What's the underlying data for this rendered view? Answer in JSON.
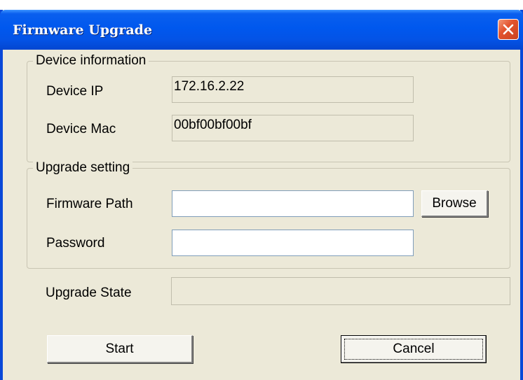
{
  "window": {
    "title": "Firmware Upgrade"
  },
  "device_info": {
    "legend": "Device information",
    "ip_label": "Device IP",
    "ip_value": "172.16.2.22",
    "mac_label": "Device Mac",
    "mac_value": "00bf00bf00bf"
  },
  "upgrade_setting": {
    "legend": "Upgrade setting",
    "path_label": "Firmware Path",
    "path_value": "",
    "browse_label": "Browse",
    "password_label": "Password",
    "password_value": ""
  },
  "state": {
    "label": "Upgrade State",
    "value": ""
  },
  "actions": {
    "start_label": "Start",
    "cancel_label": "Cancel"
  }
}
